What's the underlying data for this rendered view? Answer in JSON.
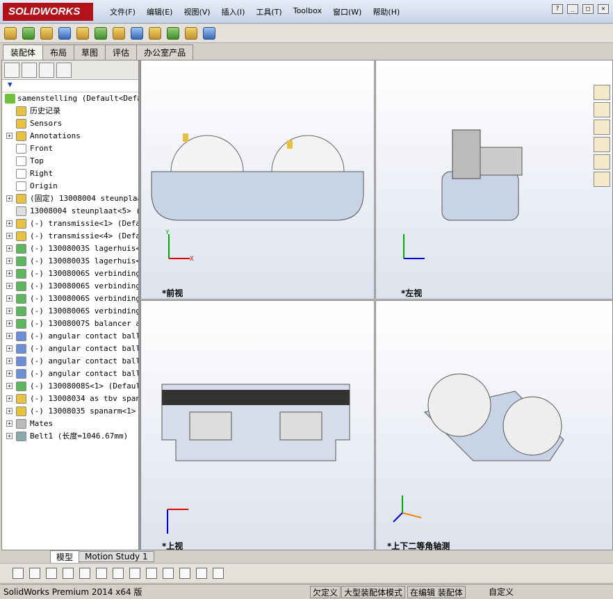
{
  "app": {
    "logo": "SOLIDWORKS",
    "menu": [
      "文件(F)",
      "编辑(E)",
      "视图(V)",
      "插入(I)",
      "工具(T)",
      "Toolbox",
      "窗口(W)",
      "帮助(H)"
    ]
  },
  "command_tabs": [
    "装配体",
    "布局",
    "草图",
    "评估",
    "办公室产品"
  ],
  "feature_tree": {
    "root": "samenstelling  (Default<Defau",
    "items": [
      {
        "label": "历史记录",
        "exp": false
      },
      {
        "label": "Sensors",
        "exp": false
      },
      {
        "label": "Annotations",
        "exp": true
      },
      {
        "label": "Front",
        "exp": false
      },
      {
        "label": "Top",
        "exp": false
      },
      {
        "label": "Right",
        "exp": false
      },
      {
        "label": "Origin",
        "exp": false
      },
      {
        "label": "(固定) 13008004 steunplaat",
        "exp": true
      },
      {
        "label": "13008004 steunplaat<5> (zc",
        "exp": false
      },
      {
        "label": "(-) transmissie<1> (Defaul",
        "exp": true
      },
      {
        "label": "(-) transmissie<4> (Defaul",
        "exp": true
      },
      {
        "label": "(-) 13008003S lagerhuis<1>",
        "exp": true
      },
      {
        "label": "(-) 13008003S lagerhuis<2>",
        "exp": true
      },
      {
        "label": "(-) 13008006S verbindingst",
        "exp": true
      },
      {
        "label": "(-) 13008006S verbindingst",
        "exp": true
      },
      {
        "label": "(-) 13008006S verbindingst",
        "exp": true
      },
      {
        "label": "(-) 13008006S verbindingst",
        "exp": true
      },
      {
        "label": "(-) 13008007S balancer arm",
        "exp": true
      },
      {
        "label": "(-) angular contact ball b",
        "exp": true
      },
      {
        "label": "(-) angular contact ball b",
        "exp": true
      },
      {
        "label": "(-) angular contact ball b",
        "exp": true
      },
      {
        "label": "(-) angular contact ball b",
        "exp": true
      },
      {
        "label": "(-) 13008008S<1> (Default)",
        "exp": true
      },
      {
        "label": "(-) 13008034 as tbv spanne",
        "exp": true
      },
      {
        "label": "(-) 13008035 spanarm<1> (I",
        "exp": true
      },
      {
        "label": "Mates",
        "exp": true
      },
      {
        "label": "Belt1 (长度=1046.67mm)",
        "exp": true
      }
    ]
  },
  "viewports": {
    "front": "*前视",
    "left": "*左视",
    "top": "*上视",
    "iso": "*上下二等角轴测"
  },
  "axes": {
    "x": "X",
    "y": "Y",
    "z": "Z"
  },
  "bottom_tabs": [
    "模型",
    "Motion Study 1"
  ],
  "status": {
    "app": "SolidWorks Premium 2014 x64 版",
    "s1": "欠定义",
    "s2": "大型装配体模式",
    "s3": "在编辑 装配体",
    "s4": "自定义"
  },
  "colors": {
    "accent": "#b3121b",
    "viewport_bg": "#dde2ee"
  }
}
